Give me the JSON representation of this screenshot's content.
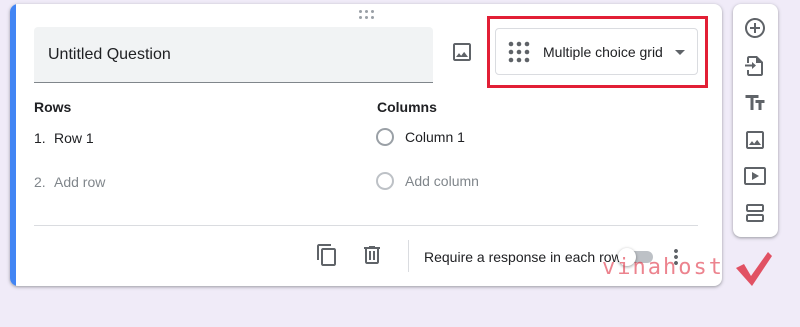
{
  "question": {
    "title": "Untitled Question",
    "type": "Multiple choice grid"
  },
  "grid": {
    "rows_header": "Rows",
    "columns_header": "Columns",
    "rows": [
      {
        "number": "1.",
        "label": "Row 1"
      }
    ],
    "add_row": {
      "number": "2.",
      "label": "Add row"
    },
    "columns": [
      {
        "label": "Column 1"
      }
    ],
    "add_column": "Add column"
  },
  "footer": {
    "require_label": "Require a response in each row",
    "require_enabled": false
  },
  "watermark": {
    "brand": "vinahost"
  },
  "colors": {
    "accent": "#4285f4",
    "highlight": "#e21f35",
    "background": "#f0ebf8"
  },
  "icons": [
    "drag-handle-icon",
    "image-icon",
    "grid-icon",
    "dropdown-arrow-icon",
    "copy-icon",
    "delete-icon",
    "more-vert-icon",
    "add-circle-icon",
    "import-icon",
    "title-icon",
    "image-icon",
    "video-icon",
    "section-icon"
  ]
}
